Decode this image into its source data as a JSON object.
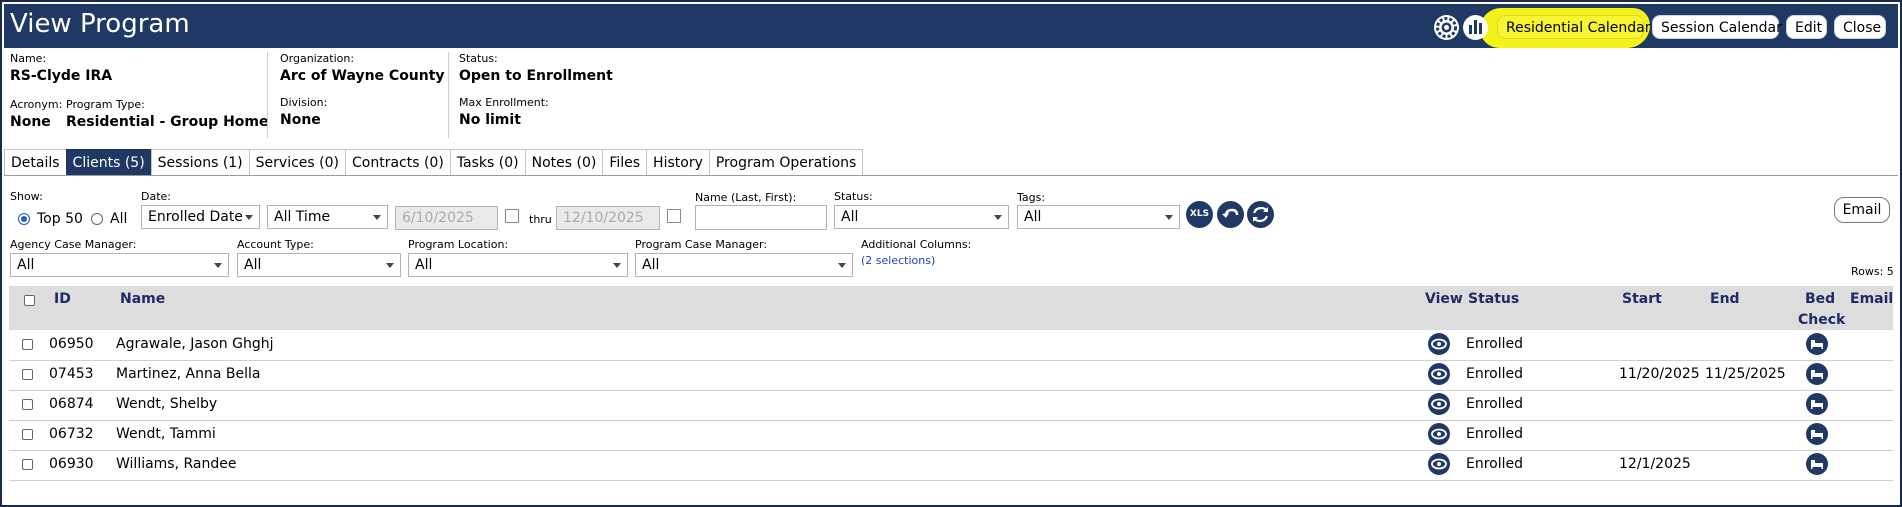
{
  "header": {
    "title": "View Program",
    "buttons": {
      "residential_calendar": "Residential Calendar",
      "session_calendar": "Session Calendar",
      "edit": "Edit",
      "close": "Close"
    },
    "icons": [
      "gear-icon",
      "chart-icon"
    ],
    "highlight_color": "#f5f218"
  },
  "info": {
    "name_label": "Name:",
    "name": "RS-Clyde IRA",
    "acronym_label": "Acronym:",
    "acronym": "None",
    "program_type_label": "Program Type:",
    "program_type": "Residential - Group Home",
    "organization_label": "Organization:",
    "organization": "Arc of Wayne County",
    "division_label": "Division:",
    "division": "None",
    "status_label": "Status:",
    "status": "Open to Enrollment",
    "max_enrollment_label": "Max Enrollment:",
    "max_enrollment": "No limit"
  },
  "tabs": [
    {
      "label": "Details"
    },
    {
      "label": "Clients (5)",
      "active": true
    },
    {
      "label": "Sessions (1)"
    },
    {
      "label": "Services (0)"
    },
    {
      "label": "Contracts (0)"
    },
    {
      "label": "Tasks (0)"
    },
    {
      "label": "Notes (0)"
    },
    {
      "label": "Files"
    },
    {
      "label": "History"
    },
    {
      "label": "Program Operations"
    }
  ],
  "filters": {
    "show_label": "Show:",
    "show_top50": "Top 50",
    "show_all": "All",
    "date_label": "Date:",
    "date_field": "Enrolled Date",
    "date_range": "All Time",
    "date_from": "6/10/2025",
    "thru": "thru",
    "date_to": "12/10/2025",
    "name_label": "Name (Last, First):",
    "status_label": "Status:",
    "status_value": "All",
    "tags_label": "Tags:",
    "tags_value": "All",
    "xls": "XLS",
    "email": "Email",
    "agency_cm_label": "Agency Case Manager:",
    "agency_cm_value": "All",
    "account_type_label": "Account Type:",
    "account_type_value": "All",
    "program_location_label": "Program Location:",
    "program_location_value": "All",
    "program_cm_label": "Program Case Manager:",
    "program_cm_value": "All",
    "additional_columns_label": "Additional Columns:",
    "additional_columns_value": "(2 selections)",
    "rows_count": "Rows: 5"
  },
  "table": {
    "columns": {
      "id": "ID",
      "name": "Name",
      "view": "View",
      "status": "Status",
      "start": "Start",
      "end": "End",
      "bed_check_1": "Bed",
      "bed_check_2": "Check",
      "email": "Email"
    },
    "rows": [
      {
        "id": "06950",
        "name": "Agrawale, Jason Ghghj",
        "status": "Enrolled",
        "start": "",
        "end": ""
      },
      {
        "id": "07453",
        "name": "Martinez, Anna Bella",
        "status": "Enrolled",
        "start": "11/20/2025",
        "end": "11/25/2025"
      },
      {
        "id": "06874",
        "name": "Wendt, Shelby",
        "status": "Enrolled",
        "start": "",
        "end": ""
      },
      {
        "id": "06732",
        "name": "Wendt, Tammi",
        "status": "Enrolled",
        "start": "",
        "end": ""
      },
      {
        "id": "06930",
        "name": "Williams, Randee",
        "status": "Enrolled",
        "start": "12/1/2025",
        "end": ""
      }
    ]
  }
}
